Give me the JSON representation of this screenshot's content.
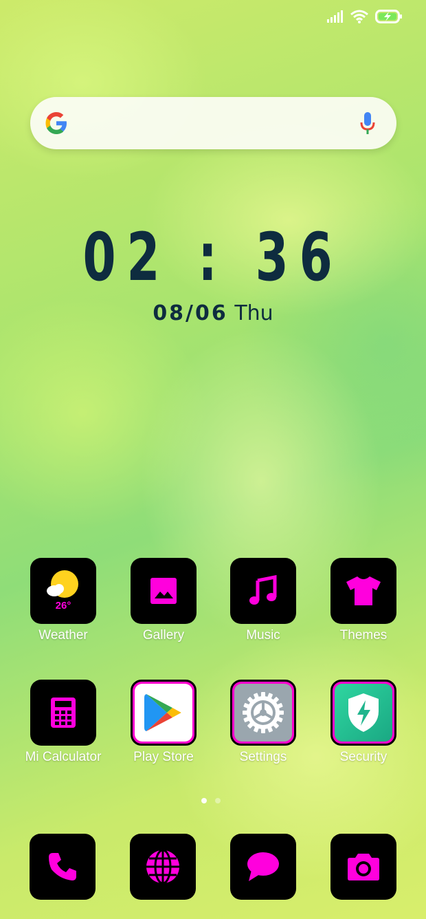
{
  "search": {
    "placeholder": ""
  },
  "clock": {
    "time": "02 : 36"
  },
  "date": {
    "day_month": "08/06",
    "weekday": "Thu"
  },
  "weather": {
    "temperature": "26°"
  },
  "apps_row1": [
    {
      "label": "Weather",
      "icon": "weather-icon"
    },
    {
      "label": "Gallery",
      "icon": "image-icon"
    },
    {
      "label": "Music",
      "icon": "music-note-icon"
    },
    {
      "label": "Themes",
      "icon": "tshirt-icon"
    }
  ],
  "apps_row2": [
    {
      "label": "Mi Calculator",
      "icon": "calculator-icon"
    },
    {
      "label": "Play Store",
      "icon": "play-store-icon"
    },
    {
      "label": "Settings",
      "icon": "gear-icon"
    },
    {
      "label": "Security",
      "icon": "shield-bolt-icon"
    }
  ],
  "dock": [
    {
      "icon": "phone-icon"
    },
    {
      "icon": "globe-icon"
    },
    {
      "icon": "message-icon"
    },
    {
      "icon": "camera-icon"
    }
  ],
  "page_indicator": {
    "pages": 2,
    "current": 1
  },
  "colors": {
    "accent": "#ff00cc",
    "clock": "#0e2c3f",
    "icon_bg": "#000000"
  }
}
